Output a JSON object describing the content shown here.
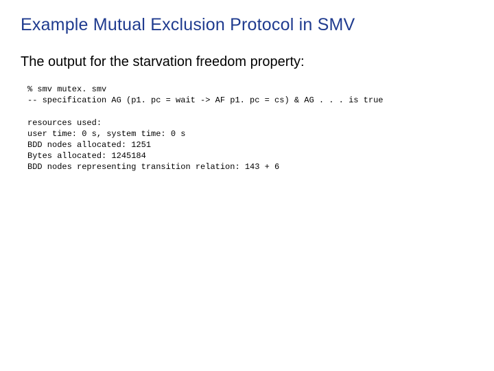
{
  "title": "Example Mutual Exclusion Protocol in SMV",
  "subtitle": "The output for the starvation freedom property:",
  "code": {
    "line1": "% smv mutex. smv",
    "line2": "-- specification AG (p1. pc = wait -> AF p1. pc = cs) & AG . . . is true",
    "blank1": "",
    "line3": "resources used:",
    "line4": "user time: 0 s, system time: 0 s",
    "line5": "BDD nodes allocated: 1251",
    "line6": "Bytes allocated: 1245184",
    "line7": "BDD nodes representing transition relation: 143 + 6"
  }
}
